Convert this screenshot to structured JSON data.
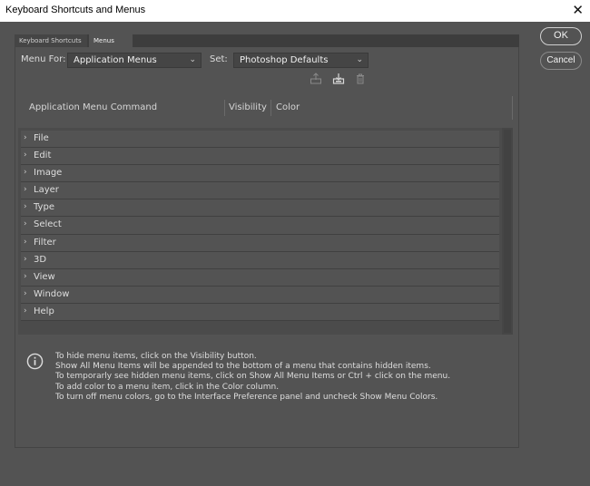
{
  "window": {
    "title": "Keyboard Shortcuts and Menus",
    "close_glyph": "✕"
  },
  "tabs": [
    {
      "label": "Keyboard Shortcuts"
    },
    {
      "label": "Menus"
    }
  ],
  "controls": {
    "menu_for_label": "Menu For:",
    "menu_for_value": "Application Menus",
    "set_label": "Set:",
    "set_value": "Photoshop Defaults"
  },
  "icon_names": [
    "save-set-icon",
    "save-set-as-icon",
    "delete-set-icon"
  ],
  "columns": {
    "command": "Application Menu Command",
    "visibility": "Visibility",
    "color": "Color"
  },
  "menu_items": [
    {
      "name": "File"
    },
    {
      "name": "Edit"
    },
    {
      "name": "Image"
    },
    {
      "name": "Layer"
    },
    {
      "name": "Type"
    },
    {
      "name": "Select"
    },
    {
      "name": "Filter"
    },
    {
      "name": "3D"
    },
    {
      "name": "View"
    },
    {
      "name": "Window"
    },
    {
      "name": "Help"
    }
  ],
  "info_lines": [
    "To hide menu items, click on the Visibility button.",
    "Show All Menu Items will be appended to the bottom of a menu that contains hidden items.",
    "To temporarly see hidden menu items, click on Show All Menu Items or Ctrl + click on the menu.",
    "To add color to a menu item, click in the Color column.",
    "To turn off menu colors, go to the Interface Preference panel and uncheck Show Menu Colors."
  ],
  "buttons": {
    "ok": "OK",
    "cancel": "Cancel"
  }
}
